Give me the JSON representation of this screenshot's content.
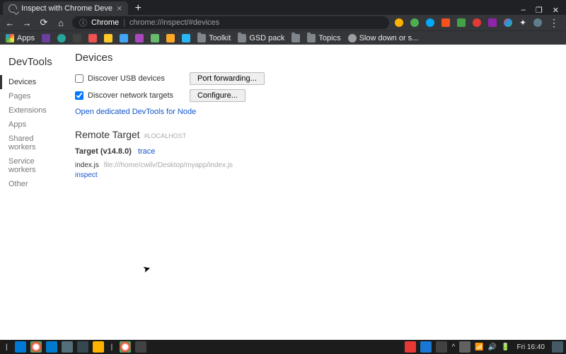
{
  "browser": {
    "tab_title": "Inspect with Chrome Deve",
    "url_scheme": "Chrome",
    "url_path": "chrome://inspect/#devices",
    "winctrl": {
      "min": "–",
      "max": "❐",
      "close": "✕"
    }
  },
  "bookmarks": [
    {
      "label": "Apps",
      "kind": "apps"
    },
    {
      "label": "",
      "kind": "ext"
    },
    {
      "label": "",
      "kind": "ext"
    },
    {
      "label": "",
      "kind": "ext"
    },
    {
      "label": "",
      "kind": "ext"
    },
    {
      "label": "",
      "kind": "ext"
    },
    {
      "label": "",
      "kind": "ext"
    },
    {
      "label": "",
      "kind": "ext"
    },
    {
      "label": "",
      "kind": "ext"
    },
    {
      "label": "",
      "kind": "ext"
    },
    {
      "label": "",
      "kind": "ext"
    },
    {
      "label": "Toolkit",
      "kind": "folder"
    },
    {
      "label": "GSD pack",
      "kind": "folder"
    },
    {
      "label": "",
      "kind": "folder"
    },
    {
      "label": "Topics",
      "kind": "folder"
    },
    {
      "label": "Slow down or s...",
      "kind": "page"
    }
  ],
  "sidebar": {
    "title": "DevTools",
    "items": [
      "Devices",
      "Pages",
      "Extensions",
      "Apps",
      "Shared workers",
      "Service workers",
      "Other"
    ],
    "active_index": 0
  },
  "devices": {
    "heading": "Devices",
    "usb": {
      "label": "Discover USB devices",
      "checked": false,
      "button": "Port forwarding..."
    },
    "network": {
      "label": "Discover network targets",
      "checked": true,
      "button": "Configure..."
    },
    "node_link": "Open dedicated DevTools for Node"
  },
  "remote": {
    "heading": "Remote Target",
    "tag": "#LOCALHOST",
    "target_name": "Target (v14.8.0)",
    "trace": "trace",
    "file_name": "index.js",
    "file_path": "file:///home/cwilv/Desktop/myapp/index.js",
    "inspect": "inspect"
  },
  "taskbar": {
    "clock": "Fri 16:40"
  },
  "colors": {
    "ext": [
      "#6b3fa0",
      "#cc3f3f",
      "#ff9800",
      "#118ab2",
      "#06d6a0",
      "#ef476f",
      "#888",
      "#4285f4",
      "#db4437",
      "#0f9d58",
      "#7e57c2",
      "#555",
      "#3f51b5"
    ]
  }
}
